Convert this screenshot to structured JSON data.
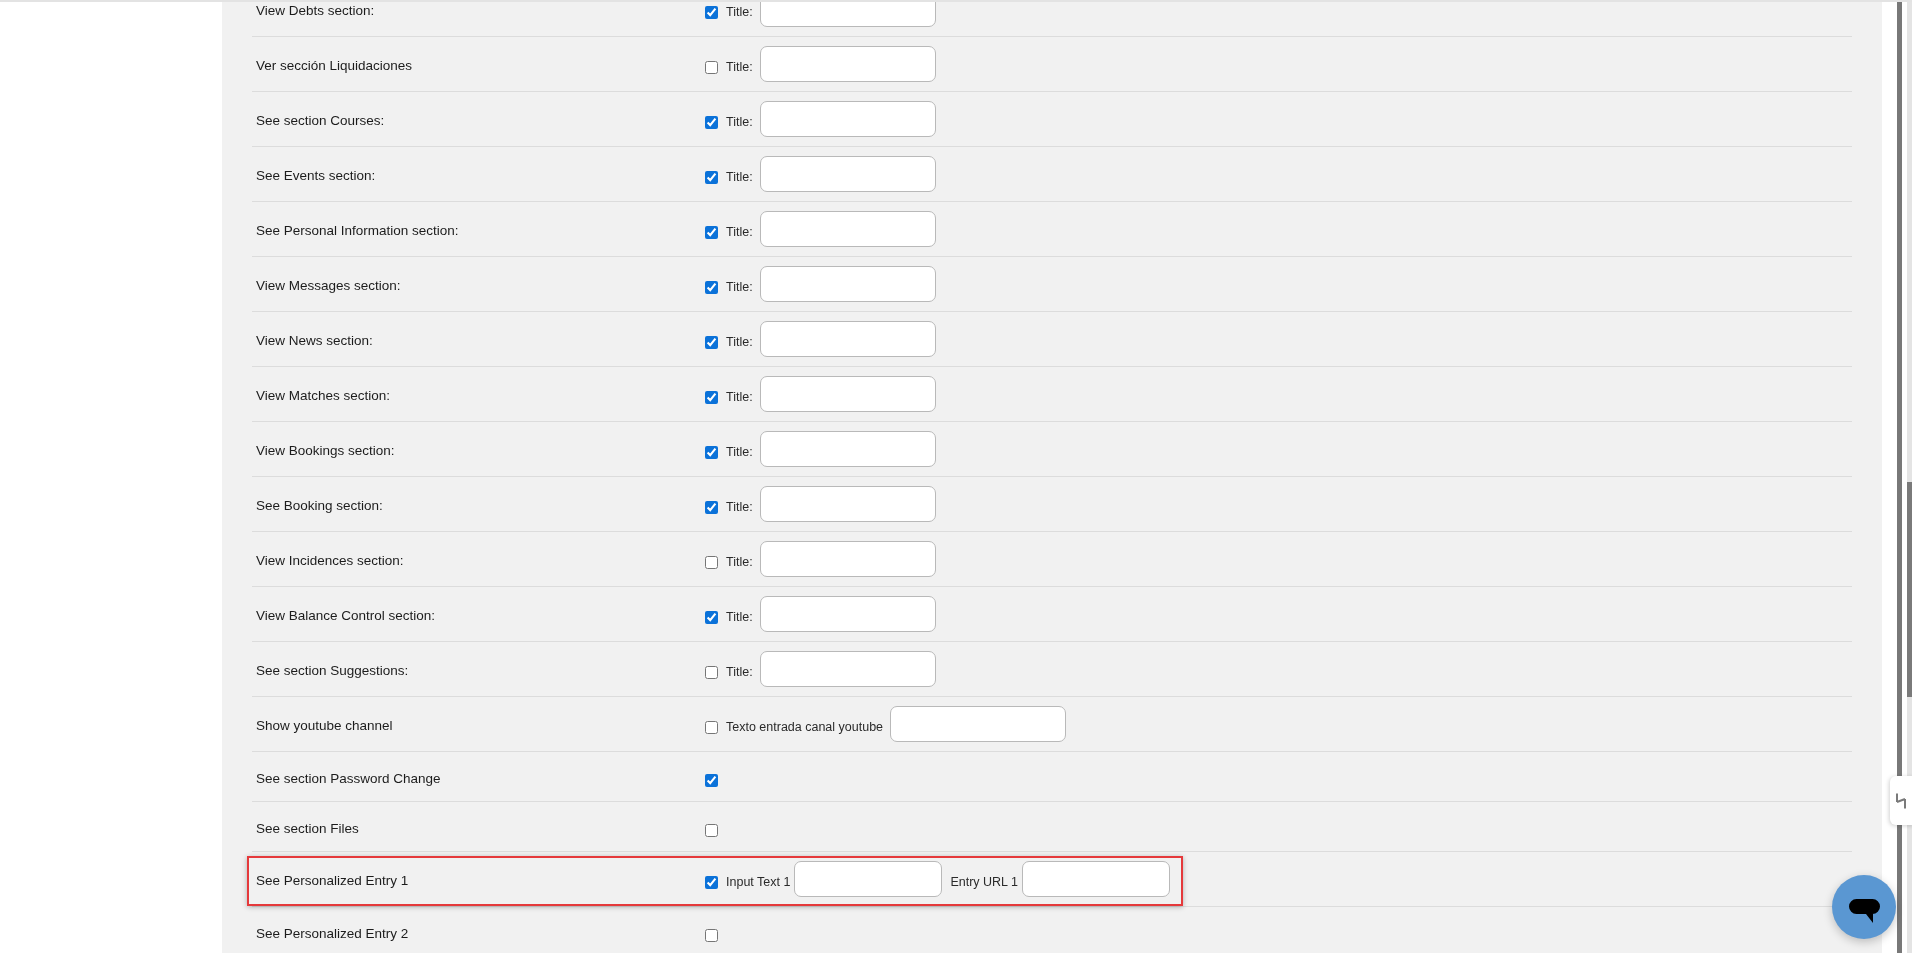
{
  "rows": [
    {
      "label": "View Debts section:",
      "checked": true,
      "highlighted": false,
      "fields": [
        {
          "label": "Title:"
        }
      ]
    },
    {
      "label": "Ver sección Liquidaciones",
      "checked": false,
      "highlighted": false,
      "fields": [
        {
          "label": "Title:"
        }
      ]
    },
    {
      "label": "See section Courses:",
      "checked": true,
      "highlighted": false,
      "fields": [
        {
          "label": "Title:"
        }
      ]
    },
    {
      "label": "See Events section:",
      "checked": true,
      "highlighted": false,
      "fields": [
        {
          "label": "Title:"
        }
      ]
    },
    {
      "label": "See Personal Information section:",
      "checked": true,
      "highlighted": false,
      "fields": [
        {
          "label": "Title:"
        }
      ]
    },
    {
      "label": "View Messages section:",
      "checked": true,
      "highlighted": false,
      "fields": [
        {
          "label": "Title:"
        }
      ]
    },
    {
      "label": "View News section:",
      "checked": true,
      "highlighted": false,
      "fields": [
        {
          "label": "Title:"
        }
      ]
    },
    {
      "label": "View Matches section:",
      "checked": true,
      "highlighted": false,
      "fields": [
        {
          "label": "Title:"
        }
      ]
    },
    {
      "label": "View Bookings section:",
      "checked": true,
      "highlighted": false,
      "fields": [
        {
          "label": "Title:"
        }
      ]
    },
    {
      "label": "See Booking section:",
      "checked": true,
      "highlighted": false,
      "fields": [
        {
          "label": "Title:"
        }
      ]
    },
    {
      "label": "View Incidences section:",
      "checked": false,
      "highlighted": false,
      "fields": [
        {
          "label": "Title:"
        }
      ]
    },
    {
      "label": "View Balance Control section:",
      "checked": true,
      "highlighted": false,
      "fields": [
        {
          "label": "Title:"
        }
      ]
    },
    {
      "label": "See section Suggestions:",
      "checked": false,
      "highlighted": false,
      "fields": [
        {
          "label": "Title:"
        }
      ]
    },
    {
      "label": "Show youtube channel",
      "checked": false,
      "highlighted": false,
      "fields": [
        {
          "label": "Texto entrada canal youtube"
        }
      ]
    },
    {
      "label": "See section Password Change",
      "checked": true,
      "highlighted": false
    },
    {
      "label": "See section Files",
      "checked": false,
      "highlighted": false
    },
    {
      "label": "See Personalized Entry 1",
      "checked": true,
      "highlighted": true,
      "fields": [
        {
          "label": "Input Text 1"
        },
        {
          "label": "Entry URL 1"
        }
      ]
    },
    {
      "label": "See Personalized Entry 2",
      "checked": false,
      "highlighted": false
    }
  ]
}
